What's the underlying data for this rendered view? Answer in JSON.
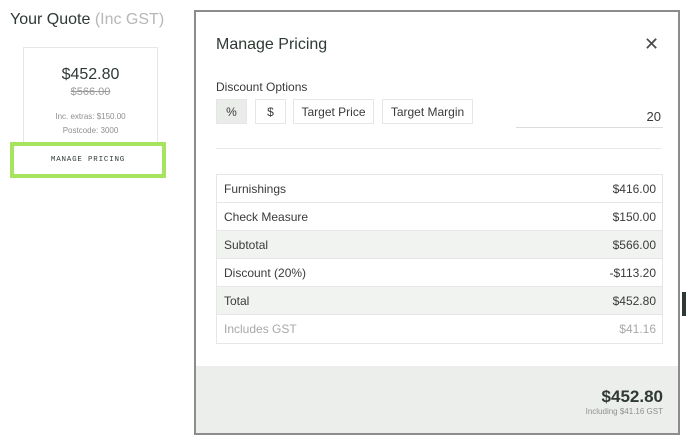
{
  "quote": {
    "title": "Your Quote",
    "title_suffix": "(Inc GST)",
    "price": "$452.80",
    "old_price": "$566.00",
    "extras": "Inc. extras: $150.00",
    "postcode": "Postcode: 3000",
    "manage_label": "MANAGE PRICING",
    "manage_highlight_color": "#a6e35f"
  },
  "modal": {
    "title": "Manage Pricing",
    "close_icon": "close-icon",
    "discount_label": "Discount Options",
    "options": [
      "%",
      "$",
      "Target Price",
      "Target Margin"
    ],
    "active_option": "%",
    "discount_value": "20",
    "table": [
      {
        "label": "Furnishings",
        "value": "$416.00"
      },
      {
        "label": "Check Measure",
        "value": "$150.00"
      },
      {
        "label": "Subtotal",
        "value": "$566.00"
      },
      {
        "label": "Discount (20%)",
        "value": "-$113.20"
      },
      {
        "label": "Total",
        "value": "$452.80"
      },
      {
        "label": "Includes GST",
        "value": "$41.16"
      }
    ],
    "footer_total": "$452.80",
    "footer_gst": "Including $41.16 GST"
  }
}
